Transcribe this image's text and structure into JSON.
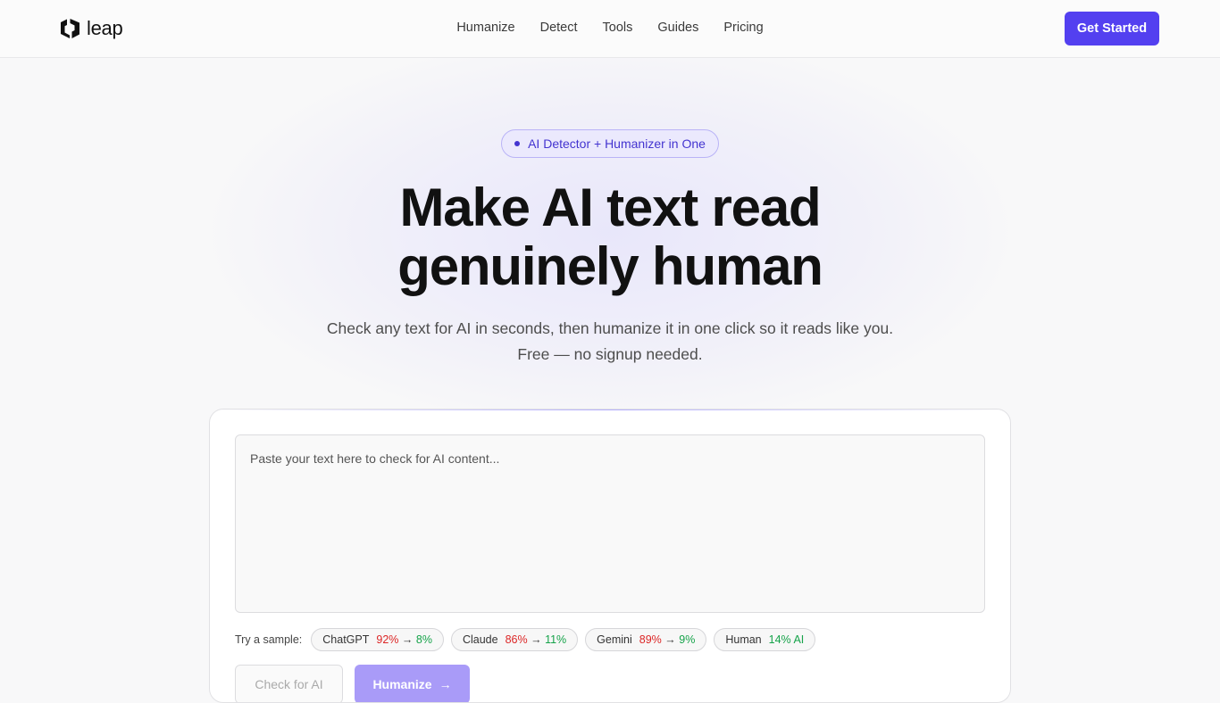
{
  "brand": {
    "name": "leap"
  },
  "nav": {
    "items": [
      {
        "label": "Humanize"
      },
      {
        "label": "Detect"
      },
      {
        "label": "Tools"
      },
      {
        "label": "Guides"
      },
      {
        "label": "Pricing"
      }
    ],
    "cta_label": "Get Started"
  },
  "hero": {
    "badge": "AI Detector + Humanizer in One",
    "title_line1": "Make AI text read",
    "title_line2": "genuinely human",
    "subtitle": "Check any text for AI in seconds, then humanize it in one click so it reads like you. Free — no signup needed."
  },
  "editor": {
    "placeholder": "Paste your text here to check for AI content...",
    "samples_label": "Try a sample:",
    "samples": [
      {
        "name": "ChatGPT",
        "from": "92%",
        "arrow": "→",
        "to": "8%"
      },
      {
        "name": "Claude",
        "from": "86%",
        "arrow": "→",
        "to": "11%"
      },
      {
        "name": "Gemini",
        "from": "89%",
        "arrow": "→",
        "to": "9%"
      },
      {
        "name": "Human",
        "to": "14% AI"
      }
    ],
    "check_label": "Check for AI",
    "humanize_label": "Humanize",
    "humanize_icon": "arrow-right-icon"
  },
  "colors": {
    "accent": "#5340f0",
    "badge_text": "#4334d0",
    "ai_red": "#dc2626",
    "human_green": "#16a34a"
  }
}
